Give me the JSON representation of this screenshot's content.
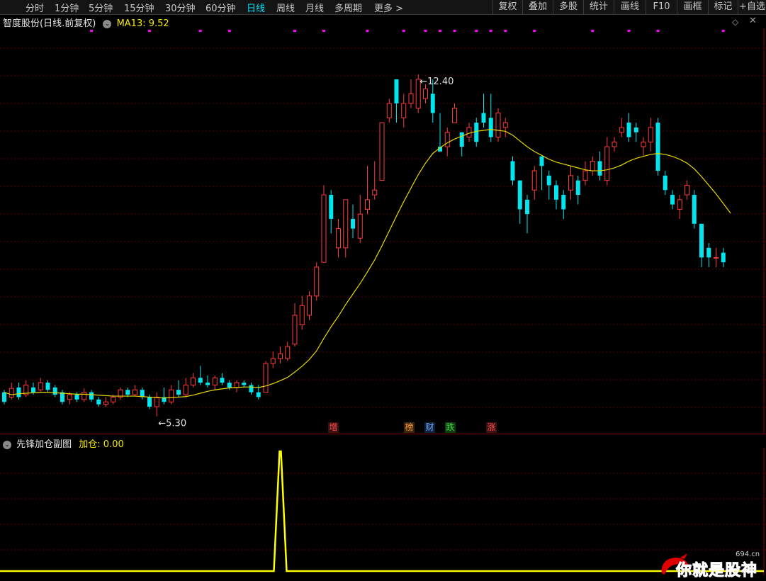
{
  "toolbar": {
    "periods": [
      {
        "label": "分时",
        "active": false
      },
      {
        "label": "1分钟",
        "active": false
      },
      {
        "label": "5分钟",
        "active": false
      },
      {
        "label": "15分钟",
        "active": false
      },
      {
        "label": "30分钟",
        "active": false
      },
      {
        "label": "60分钟",
        "active": false
      },
      {
        "label": "日线",
        "active": true
      },
      {
        "label": "周线",
        "active": false
      },
      {
        "label": "月线",
        "active": false
      },
      {
        "label": "多周期",
        "active": false
      },
      {
        "label": "更多 >",
        "active": false
      }
    ],
    "buttons": [
      "复权",
      "叠加",
      "多股",
      "统计",
      "画线",
      "F10",
      "画框",
      "标记",
      "+自选"
    ]
  },
  "main_panel": {
    "title": "智度股份(日线.前复权)",
    "ma_label": "MA13: 9.52",
    "high_label": "12.40",
    "low_label": "5.30"
  },
  "markers": [
    {
      "text": "增",
      "color": "#ff4d4d",
      "bg": "#3a1010"
    },
    {
      "text": "榜",
      "color": "#ff9a3c",
      "bg": "#3a2410"
    },
    {
      "text": "财",
      "color": "#6fa8ff",
      "bg": "#10203a"
    },
    {
      "text": "跌",
      "color": "#3cd33c",
      "bg": "#103a10"
    },
    {
      "text": "涨",
      "color": "#ff4d4d",
      "bg": "#3a1010"
    }
  ],
  "sub_panel": {
    "title": "先锋加仓副图",
    "value_label": "加仓: 0.00"
  },
  "watermark": {
    "text": "你就是股神",
    "url": "694.cn"
  },
  "colors": {
    "up": "#ff3a3a",
    "down": "#00e5ee",
    "ma": "#e6d800",
    "signal": "#ff00ff",
    "sub_line": "#ffff00"
  },
  "chart_data": [
    {
      "type": "candlestick",
      "title": "智度股份(日线.前复权)",
      "ma_period": 13,
      "y_range": [
        5.0,
        13.0
      ],
      "high": 12.4,
      "low": 5.3,
      "candles": [
        [
          5.8,
          5.6,
          5.85,
          5.55
        ],
        [
          5.7,
          5.88,
          6.0,
          5.65
        ],
        [
          5.9,
          5.7,
          6.0,
          5.65
        ],
        [
          5.75,
          5.95,
          6.05,
          5.7
        ],
        [
          5.9,
          5.8,
          6.0,
          5.75
        ],
        [
          5.85,
          6.0,
          6.1,
          5.8
        ],
        [
          6.0,
          5.85,
          6.05,
          5.8
        ],
        [
          5.9,
          5.75,
          5.95,
          5.7
        ],
        [
          5.8,
          5.6,
          5.85,
          5.55
        ],
        [
          5.65,
          5.75,
          5.8,
          5.55
        ],
        [
          5.75,
          5.65,
          5.8,
          5.6
        ],
        [
          5.65,
          5.8,
          5.88,
          5.6
        ],
        [
          5.8,
          5.65,
          5.85,
          5.6
        ],
        [
          5.65,
          5.55,
          5.7,
          5.5
        ],
        [
          5.55,
          5.6,
          5.7,
          5.5
        ],
        [
          5.6,
          5.7,
          5.75,
          5.55
        ],
        [
          5.7,
          5.85,
          5.9,
          5.65
        ],
        [
          5.85,
          5.75,
          5.9,
          5.7
        ],
        [
          5.75,
          5.85,
          5.95,
          5.72
        ],
        [
          5.85,
          5.7,
          5.9,
          5.65
        ],
        [
          5.7,
          5.5,
          5.75,
          5.45
        ],
        [
          5.5,
          5.7,
          5.8,
          5.3
        ],
        [
          5.7,
          5.6,
          5.9,
          5.55
        ],
        [
          5.6,
          5.85,
          5.95,
          5.55
        ],
        [
          5.85,
          5.75,
          6.05,
          5.7
        ],
        [
          5.75,
          5.95,
          6.1,
          5.7
        ],
        [
          5.95,
          6.1,
          6.2,
          5.9
        ],
        [
          6.1,
          6.0,
          6.35,
          5.95
        ],
        [
          6.0,
          5.95,
          6.15,
          5.9
        ],
        [
          5.95,
          6.1,
          6.15,
          5.85
        ],
        [
          6.1,
          6.0,
          6.2,
          5.95
        ],
        [
          6.0,
          5.9,
          6.05,
          5.85
        ],
        [
          5.9,
          6.0,
          6.05,
          5.8
        ],
        [
          6.0,
          5.95,
          6.05,
          5.9
        ],
        [
          5.95,
          5.8,
          6.0,
          5.75
        ],
        [
          5.8,
          5.7,
          5.95,
          5.65
        ],
        [
          5.8,
          6.4,
          6.45,
          5.8
        ],
        [
          6.4,
          6.5,
          6.65,
          6.3
        ],
        [
          6.5,
          6.6,
          6.75,
          6.4
        ],
        [
          6.5,
          6.75,
          6.85,
          6.45
        ],
        [
          6.8,
          7.4,
          7.65,
          6.75
        ],
        [
          7.2,
          7.6,
          7.8,
          7.1
        ],
        [
          7.4,
          7.8,
          7.9,
          7.3
        ],
        [
          7.8,
          8.4,
          8.5,
          7.7
        ],
        [
          8.5,
          9.9,
          10.1,
          8.5
        ],
        [
          9.9,
          9.4,
          10.0,
          9.1
        ],
        [
          8.8,
          9.2,
          9.4,
          8.6
        ],
        [
          8.8,
          9.8,
          9.8,
          8.6
        ],
        [
          9.4,
          9.2,
          9.7,
          9.0
        ],
        [
          9.0,
          9.5,
          9.9,
          8.9
        ],
        [
          9.6,
          9.8,
          10.5,
          9.5
        ],
        [
          9.9,
          10.0,
          10.6,
          9.8
        ],
        [
          10.2,
          11.4,
          11.4,
          10.2
        ],
        [
          11.5,
          11.8,
          11.9,
          11.4
        ],
        [
          12.3,
          11.8,
          12.3,
          11.4
        ],
        [
          11.5,
          11.8,
          12.0,
          11.3
        ],
        [
          11.8,
          12.0,
          12.3,
          11.7
        ],
        [
          11.7,
          12.3,
          12.4,
          11.6
        ],
        [
          11.9,
          12.1,
          12.2,
          11.8
        ],
        [
          12.0,
          11.6,
          12.3,
          11.4
        ],
        [
          10.9,
          10.8,
          11.6,
          10.8
        ],
        [
          10.9,
          11.2,
          11.3,
          10.7
        ],
        [
          11.4,
          11.7,
          11.8,
          11.4
        ],
        [
          11.2,
          10.9,
          11.2,
          10.7
        ],
        [
          11.1,
          11.3,
          11.4,
          11.0
        ],
        [
          11.4,
          11.0,
          11.5,
          10.9
        ],
        [
          11.6,
          11.4,
          12.0,
          11.3
        ],
        [
          11.5,
          11.1,
          12.0,
          11.0
        ],
        [
          11.1,
          11.6,
          11.7,
          11.0
        ],
        [
          11.3,
          11.4,
          11.5,
          11.1
        ],
        [
          10.6,
          10.2,
          10.7,
          10.1
        ],
        [
          10.2,
          9.6,
          10.2,
          9.3
        ],
        [
          9.8,
          9.5,
          9.9,
          9.1
        ],
        [
          10.0,
          10.4,
          10.5,
          9.8
        ],
        [
          10.7,
          10.5,
          10.7,
          10.0
        ],
        [
          10.3,
          10.1,
          10.4,
          9.8
        ],
        [
          10.1,
          9.8,
          10.2,
          9.6
        ],
        [
          9.9,
          9.6,
          10.0,
          9.4
        ],
        [
          10.0,
          10.3,
          10.5,
          9.8
        ],
        [
          10.2,
          9.9,
          10.3,
          9.7
        ],
        [
          10.2,
          10.4,
          10.6,
          10.1
        ],
        [
          10.4,
          10.6,
          10.7,
          10.3
        ],
        [
          10.6,
          10.3,
          10.8,
          10.2
        ],
        [
          10.2,
          10.9,
          11.1,
          10.1
        ],
        [
          10.9,
          11.0,
          11.1,
          10.8
        ],
        [
          11.2,
          11.3,
          11.5,
          11.1
        ],
        [
          11.4,
          11.1,
          11.6,
          11.0
        ],
        [
          11.3,
          11.2,
          11.4,
          11.0
        ],
        [
          10.9,
          11.0,
          11.1,
          10.7
        ],
        [
          11.0,
          11.3,
          11.5,
          10.8
        ],
        [
          11.4,
          10.4,
          11.5,
          10.3
        ],
        [
          10.3,
          10.0,
          10.4,
          9.9
        ],
        [
          9.9,
          9.7,
          10.0,
          9.6
        ],
        [
          9.6,
          9.8,
          9.9,
          9.4
        ],
        [
          9.9,
          10.1,
          10.2,
          9.8
        ],
        [
          9.9,
          9.3,
          10.0,
          9.2
        ],
        [
          9.3,
          8.6,
          9.3,
          8.4
        ],
        [
          8.8,
          8.6,
          8.9,
          8.4
        ],
        [
          8.6,
          8.6,
          8.8,
          8.4
        ],
        [
          8.7,
          8.5,
          8.8,
          8.4
        ]
      ],
      "ma13": [
        5.8,
        5.75,
        5.77,
        5.78,
        5.79,
        5.8,
        5.8,
        5.79,
        5.78,
        5.77,
        5.76,
        5.76,
        5.75,
        5.74,
        5.73,
        5.72,
        5.72,
        5.72,
        5.72,
        5.71,
        5.7,
        5.69,
        5.68,
        5.69,
        5.7,
        5.71,
        5.74,
        5.78,
        5.82,
        5.85,
        5.87,
        5.89,
        5.9,
        5.91,
        5.91,
        5.9,
        5.93,
        5.98,
        6.04,
        6.11,
        6.22,
        6.34,
        6.48,
        6.66,
        6.92,
        7.16,
        7.38,
        7.62,
        7.84,
        8.06,
        8.3,
        8.55,
        8.84,
        9.15,
        9.46,
        9.76,
        10.04,
        10.32,
        10.56,
        10.76,
        10.88,
        10.98,
        11.06,
        11.12,
        11.18,
        11.22,
        11.24,
        11.26,
        11.24,
        11.22,
        11.14,
        11.02,
        10.9,
        10.8,
        10.72,
        10.64,
        10.58,
        10.54,
        10.5,
        10.46,
        10.42,
        10.4,
        10.4,
        10.42,
        10.46,
        10.52,
        10.6,
        10.66,
        10.7,
        10.74,
        10.76,
        10.74,
        10.7,
        10.64,
        10.56,
        10.44,
        10.28,
        10.1,
        9.92,
        9.72,
        9.52
      ],
      "signal_indices": [
        12,
        20,
        27,
        31,
        40,
        44,
        50,
        55,
        58,
        60,
        62,
        65,
        67,
        69,
        73,
        81,
        86,
        90,
        99
      ]
    },
    {
      "type": "line",
      "title": "先锋加仓副图",
      "series": [
        {
          "name": "加仓",
          "values_spike": {
            "index": 38,
            "value": 1.0
          },
          "baseline": 0.0
        }
      ],
      "current": 0.0
    }
  ]
}
